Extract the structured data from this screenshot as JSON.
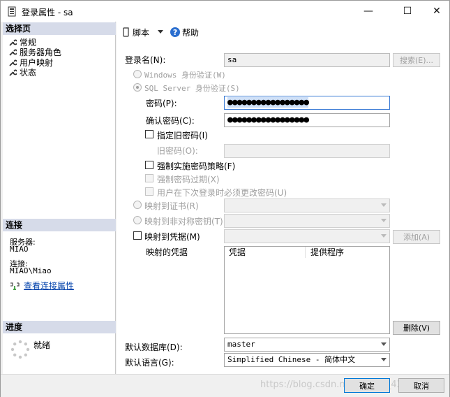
{
  "window": {
    "title": "登录属性 - sa",
    "min_glyph": "—",
    "max_glyph": "☐",
    "close_glyph": "✕"
  },
  "left_panel": {
    "select_page_header": "选择页",
    "pages": [
      "常规",
      "服务器角色",
      "用户映射",
      "状态"
    ],
    "connection_header": "连接",
    "server_label": "服务器:",
    "server_value": "MIAO",
    "connection_label": "连接:",
    "connection_value": "MIAO\\Miao",
    "view_conn_props": "查看连接属性",
    "progress_header": "进度",
    "progress_status": "就绪"
  },
  "toolbar": {
    "script_label": "脚本",
    "help_label": "帮助"
  },
  "form": {
    "login_name_label": "登录名(N):",
    "login_name_value": "sa",
    "search_button": "搜索(E)...",
    "windows_auth": "Windows 身份验证(W)",
    "sql_auth": "SQL Server 身份验证(S)",
    "password_label": "密码(P):",
    "password_value": "●●●●●●●●●●●●●●●●●",
    "confirm_password_label": "确认密码(C):",
    "confirm_password_value": "●●●●●●●●●●●●●●●●●",
    "specify_old_password": "指定旧密码(I)",
    "old_password_label": "旧密码(O):",
    "enforce_policy": "强制实施密码策略(F)",
    "enforce_expiration": "强制密码过期(X)",
    "must_change": "用户在下次登录时必须更改密码(U)",
    "map_certificate": "映射到证书(R)",
    "map_asym_key": "映射到非对称密钥(T)",
    "map_credential": "映射到凭据(M)",
    "add_button": "添加(A)",
    "mapped_credentials_label": "映射的凭据",
    "col_credential": "凭据",
    "col_provider": "提供程序",
    "remove_button": "删除(V)",
    "default_db_label": "默认数据库(D):",
    "default_db_value": "master",
    "default_lang_label": "默认语言(G):",
    "default_lang_value": "Simplified Chinese - 简体中文"
  },
  "footer": {
    "ok_button": "确定",
    "cancel_button": "取消",
    "watermark": "https://blog.csdn.net/weixin_43670348"
  }
}
